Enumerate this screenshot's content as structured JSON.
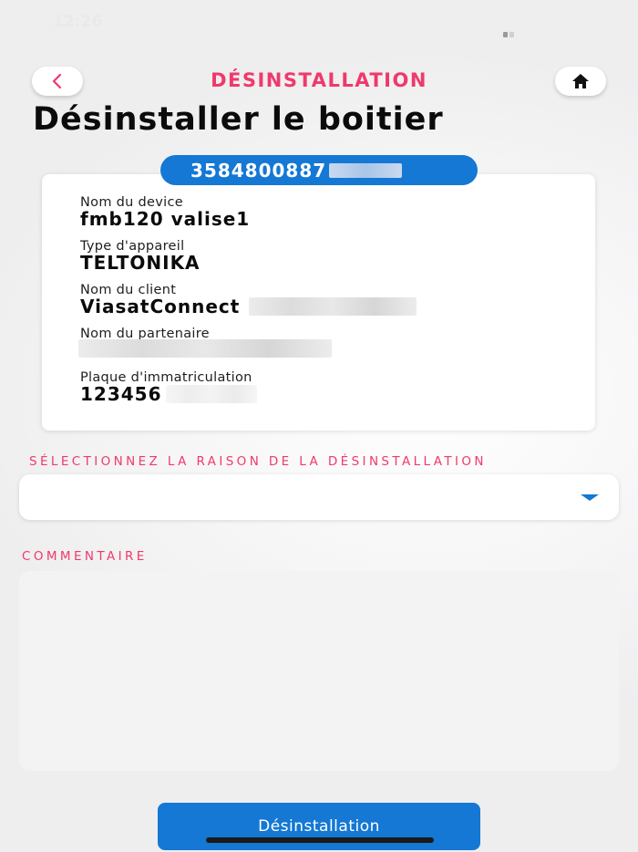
{
  "status_bar": {
    "time": "12:26"
  },
  "header": {
    "title": "DÉSINSTALLATION",
    "back_icon": "chevron-left-icon",
    "home_icon": "home-icon"
  },
  "page": {
    "title": "Désinstaller le boitier"
  },
  "device": {
    "imei": "3584800887",
    "fields": [
      {
        "label": "Nom du device",
        "value": "fmb120 valise1"
      },
      {
        "label": "Type d'appareil",
        "value": "TELTONIKA"
      },
      {
        "label": "Nom du client",
        "value": "ViasatConnect"
      },
      {
        "label": "Nom du partenaire",
        "value": ""
      },
      {
        "label": "Plaque d'immatriculation",
        "value": "123456"
      }
    ]
  },
  "reason": {
    "label": "SÉLECTIONNEZ LA RAISON DE LA DÉSINSTALLATION",
    "selected": ""
  },
  "comment": {
    "label": "COMMENTAIRE",
    "value": ""
  },
  "submit": {
    "label": "Désinstallation"
  },
  "colors": {
    "accent": "#f0396b",
    "primary": "#1478d4"
  }
}
